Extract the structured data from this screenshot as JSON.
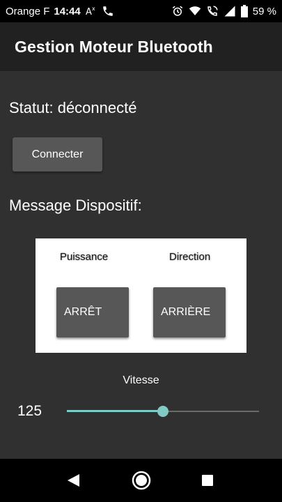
{
  "statusbar": {
    "carrier": "Orange F",
    "time": "14:44",
    "battery": "59 %",
    "icons": [
      "translate-icon",
      "phone-icon",
      "alarm-icon",
      "wifi-icon",
      "wifi-call-icon",
      "signal-icon",
      "battery-icon"
    ]
  },
  "appbar": {
    "title": "Gestion Moteur Bluetooth"
  },
  "main": {
    "status": "Statut: déconnecté",
    "connect_button": "Connecter",
    "message_label": "Message Dispositif:"
  },
  "panel": {
    "puissance_label": "Puissance",
    "direction_label": "Direction",
    "power_button": "ARRÊT",
    "direction_button": "ARRIÈRE"
  },
  "speed": {
    "label": "Vitesse",
    "value": "125",
    "fraction": 0.5
  },
  "colors": {
    "accent": "#80cbc4",
    "background": "#303030",
    "appbar": "#212121",
    "button": "#575757"
  },
  "navbar": {
    "icons": [
      "back-icon",
      "home-icon",
      "recent-apps-icon"
    ]
  }
}
